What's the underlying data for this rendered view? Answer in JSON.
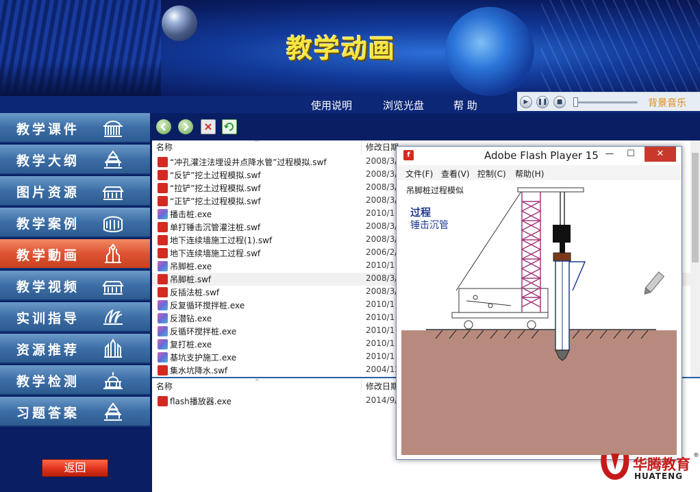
{
  "banner": {
    "title": "教学动画"
  },
  "top_nav": {
    "items": [
      "使用说明",
      "浏览光盘",
      "帮 助"
    ]
  },
  "music_player": {
    "label": "背景音乐",
    "buttons": [
      "play-icon",
      "pause-icon",
      "stop-icon"
    ],
    "position": 0.0
  },
  "sidebar": {
    "items": [
      {
        "label": "教学课件",
        "icon": "building-icon",
        "active": false
      },
      {
        "label": "教学大纲",
        "icon": "temple-icon",
        "active": false
      },
      {
        "label": "图片资源",
        "icon": "palace-icon",
        "active": false
      },
      {
        "label": "教学案例",
        "icon": "colosseum-icon",
        "active": false
      },
      {
        "label": "教学動画",
        "icon": "cathedral-icon",
        "active": true
      },
      {
        "label": "教学视频",
        "icon": "palace-icon",
        "active": false
      },
      {
        "label": "实训指导",
        "icon": "opera-house-icon",
        "active": false
      },
      {
        "label": "资源推荐",
        "icon": "castle-icon",
        "active": false
      },
      {
        "label": "教学检测",
        "icon": "capitol-icon",
        "active": false
      },
      {
        "label": "习题答案",
        "icon": "temple-icon",
        "active": false
      }
    ],
    "back_label": "返回"
  },
  "toolbar": {
    "buttons": [
      "back-arrow-icon",
      "forward-arrow-icon",
      "delete-icon",
      "refresh-icon"
    ]
  },
  "file_list_top": {
    "columns": [
      "名称",
      "修改日期"
    ],
    "rows": [
      {
        "name": "“冲孔灌注法埋设井点降水管”过程模拟.swf",
        "type": "swf",
        "date": "2008/3/"
      },
      {
        "name": "“反铲”挖土过程模拟.swf",
        "type": "swf",
        "date": "2008/3/"
      },
      {
        "name": "“拉铲”挖土过程模拟.swf",
        "type": "swf",
        "date": "2008/3/"
      },
      {
        "name": "“正铲”挖土过程模拟.swf",
        "type": "swf",
        "date": "2008/3/"
      },
      {
        "name": "播击桩.exe",
        "type": "exe",
        "date": "2010/1"
      },
      {
        "name": "单打锤击沉管灌注桩.swf",
        "type": "swf",
        "date": "2008/3/"
      },
      {
        "name": "地下连续墙施工过程(1).swf",
        "type": "swf",
        "date": "2008/3/"
      },
      {
        "name": "地下连续墙施工过程.swf",
        "type": "swf",
        "date": "2006/2/"
      },
      {
        "name": "吊脚桩.exe",
        "type": "exe",
        "date": "2010/1"
      },
      {
        "name": "吊脚桩.swf",
        "type": "swf",
        "date": "2008/3/",
        "selected": true
      },
      {
        "name": "反插法桩.swf",
        "type": "swf",
        "date": "2008/3/"
      },
      {
        "name": "反复循环搅拌桩.exe",
        "type": "exe",
        "date": "2010/1"
      },
      {
        "name": "反潜钻.exe",
        "type": "exe",
        "date": "2010/1"
      },
      {
        "name": "反循环搅拌桩.exe",
        "type": "exe",
        "date": "2010/1"
      },
      {
        "name": "复打桩.exe",
        "type": "exe",
        "date": "2010/1"
      },
      {
        "name": "基坑支护施工.exe",
        "type": "exe",
        "date": "2010/1"
      },
      {
        "name": "集水坑降水.swf",
        "type": "swf",
        "date": "2004/12"
      }
    ]
  },
  "file_list_bottom": {
    "columns": [
      "名称",
      "修改日期"
    ],
    "rows": [
      {
        "name": "flash播放器.exe",
        "type": "swf",
        "date": "2014/9/"
      }
    ]
  },
  "flash_window": {
    "title": "Adobe Flash Player 15",
    "controls": [
      "minimize-icon",
      "maximize-icon",
      "close-icon"
    ],
    "close_glyph": "✕",
    "menus": [
      "文件(F)",
      "查看(V)",
      "控制(C)",
      "帮助(H)"
    ],
    "stage": {
      "caption": "吊脚桩过程模似",
      "step_name": "过程",
      "step_desc": "锤击沉管"
    }
  },
  "logo": {
    "cn": "华腾教育",
    "en": "HUATENG",
    "mark": "®"
  },
  "colors": {
    "nav_bg": "#0d2777",
    "menu_blue": "#3c6ea6",
    "menu_active": "#de5432",
    "banner_title": "#f6e642",
    "music_label": "#e08a12",
    "soil": "#b88a7e",
    "crane": "#a33a7c"
  }
}
